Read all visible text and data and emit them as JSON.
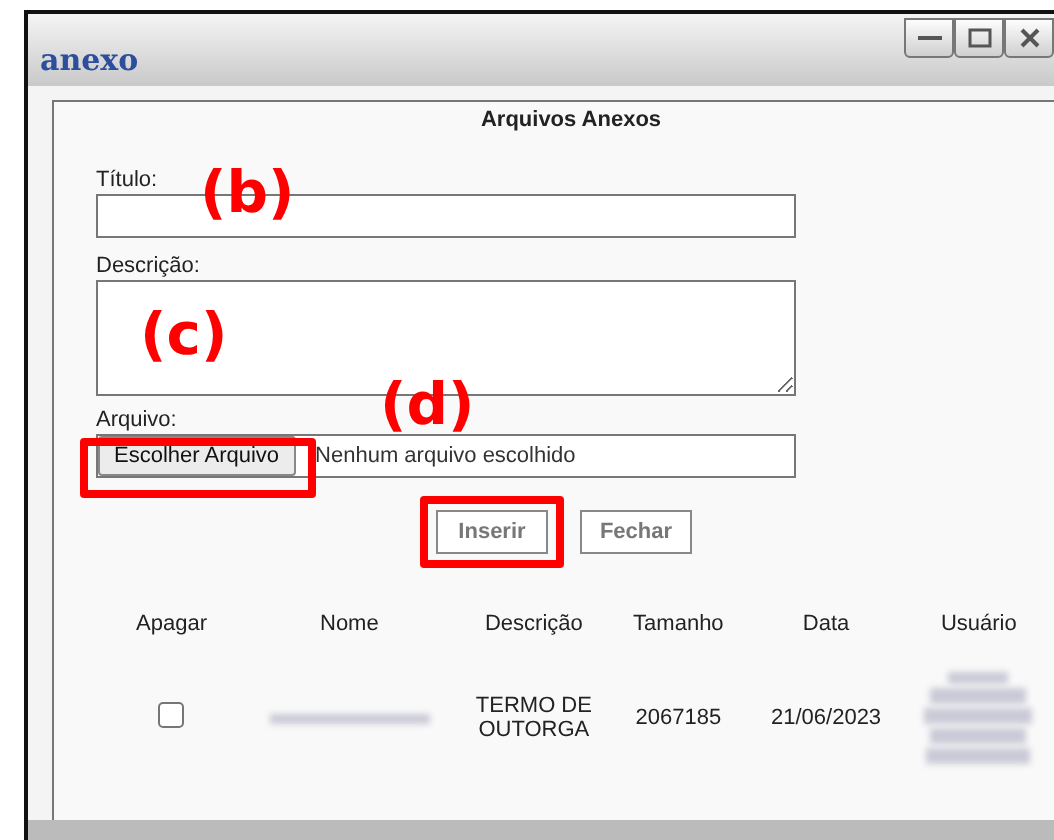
{
  "window": {
    "title": "anexo"
  },
  "form": {
    "heading": "Arquivos Anexos",
    "title_field": {
      "label": "Título:",
      "annotation": "(b)"
    },
    "description_field": {
      "label": "Descrição:",
      "annotation": "(c)"
    },
    "file_field": {
      "label": "Arquivo:",
      "button": "Escolher Arquivo",
      "status": "Nenhum arquivo escolhido",
      "annotation": "(d)",
      "highlighted": true
    },
    "buttons": [
      {
        "label": "Inserir",
        "highlighted": true
      },
      {
        "label": "Fechar",
        "highlighted": false
      }
    ]
  },
  "table": {
    "columns": [
      "Apagar",
      "Nome",
      "Descrição",
      "Tamanho",
      "Data",
      "Usuário"
    ],
    "rows": [
      {
        "checked": false,
        "name_redacted": true,
        "description": "TERMO DE OUTORGA",
        "size": "2067185",
        "date": "21/06/2023",
        "user_redacted": true
      }
    ]
  }
}
